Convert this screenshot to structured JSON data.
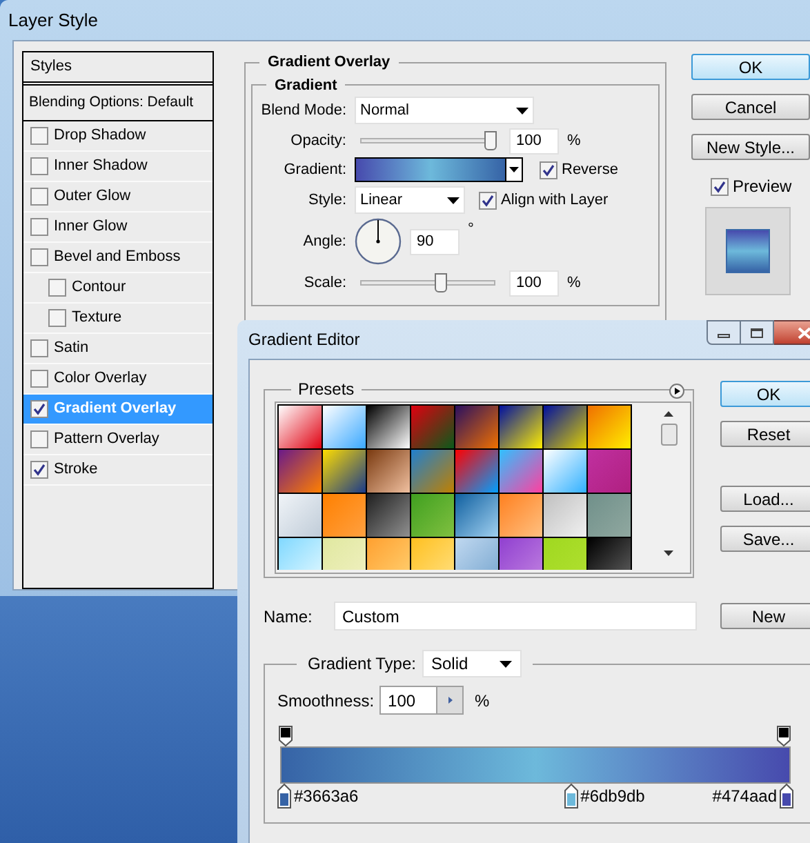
{
  "layer_style": {
    "title": "Layer Style",
    "styles_header": "Styles",
    "blending_options": "Blending Options: Default",
    "effects": [
      {
        "label": "Drop Shadow",
        "checked": false,
        "selected": false
      },
      {
        "label": "Inner Shadow",
        "checked": false,
        "selected": false
      },
      {
        "label": "Outer Glow",
        "checked": false,
        "selected": false
      },
      {
        "label": "Inner Glow",
        "checked": false,
        "selected": false
      },
      {
        "label": "Bevel and Emboss",
        "checked": false,
        "selected": false,
        "children": [
          {
            "label": "Contour",
            "checked": false,
            "selected": false
          },
          {
            "label": "Texture",
            "checked": false,
            "selected": false
          }
        ]
      },
      {
        "label": "Satin",
        "checked": false,
        "selected": false
      },
      {
        "label": "Color Overlay",
        "checked": false,
        "selected": false
      },
      {
        "label": "Gradient Overlay",
        "checked": true,
        "selected": true
      },
      {
        "label": "Pattern Overlay",
        "checked": false,
        "selected": false
      },
      {
        "label": "Stroke",
        "checked": true,
        "selected": false
      }
    ],
    "section_title": "Gradient Overlay",
    "group_title": "Gradient",
    "blend_mode": {
      "label": "Blend Mode:",
      "value": "Normal"
    },
    "opacity": {
      "label": "Opacity:",
      "level": 0.97,
      "value": "100",
      "unit": "%"
    },
    "gradient": {
      "label": "Gradient:"
    },
    "reverse": {
      "label": "Reverse",
      "checked": true
    },
    "style": {
      "label": "Style:",
      "value": "Linear"
    },
    "align": {
      "label": "Align with Layer",
      "checked": true
    },
    "angle": {
      "label": "Angle:",
      "value": "90",
      "unit": "°"
    },
    "scale": {
      "label": "Scale:",
      "level": 0.6,
      "value": "100",
      "unit": "%"
    },
    "buttons": [
      {
        "label": "OK",
        "default": true
      },
      {
        "label": "Cancel",
        "default": false
      },
      {
        "label": "New Style...",
        "default": false
      }
    ],
    "preview": {
      "label": "Preview",
      "checked": true
    }
  },
  "gradient_editor": {
    "title": "Gradient Editor",
    "presets_label": "Presets",
    "buttons": [
      {
        "label": "OK",
        "default": true
      },
      {
        "label": "Reset",
        "default": false
      },
      {
        "label": "Load...",
        "default": false
      },
      {
        "label": "Save...",
        "default": false
      }
    ],
    "name": {
      "label": "Name:",
      "value": "Custom"
    },
    "new_button": "New",
    "gradient_type": {
      "label": "Gradient Type:",
      "value": "Solid"
    },
    "smoothness": {
      "label": "Smoothness:",
      "value": "100",
      "unit": "%"
    },
    "color_stops": [
      {
        "label": "#3663a6",
        "color": "#3663a6"
      },
      {
        "label": "#6db9db",
        "color": "#6db9db"
      },
      {
        "label": "#474aad",
        "color": "#474aad"
      }
    ]
  }
}
